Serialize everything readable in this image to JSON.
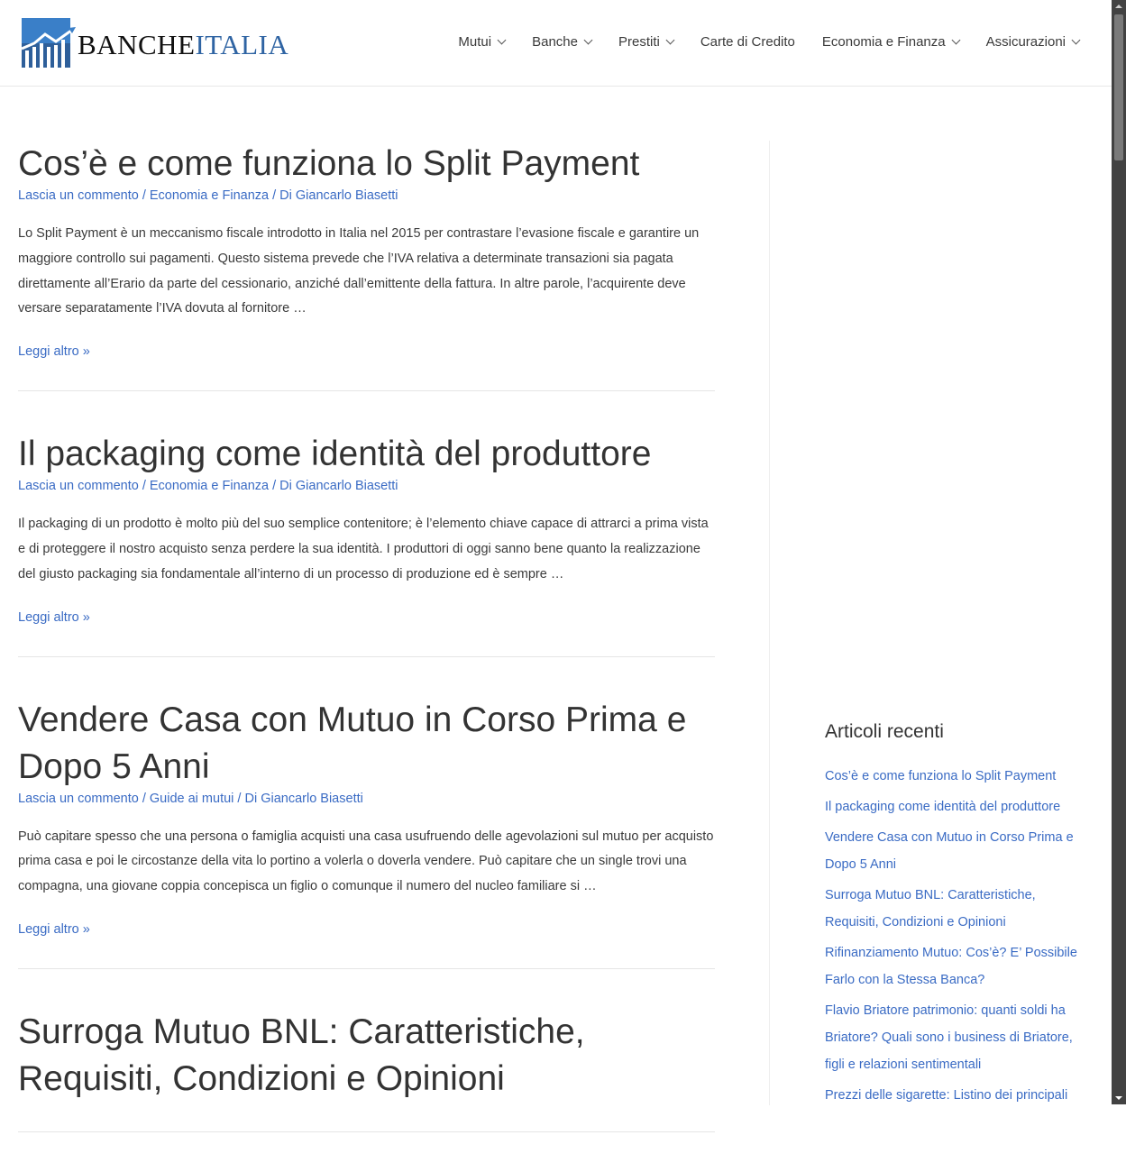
{
  "logo": {
    "part1": "BANCHE",
    "part2": "ITALIA"
  },
  "nav": [
    {
      "label": "Mutui",
      "dropdown": true
    },
    {
      "label": "Banche",
      "dropdown": true
    },
    {
      "label": "Prestiti",
      "dropdown": true
    },
    {
      "label": "Carte di Credito",
      "dropdown": false
    },
    {
      "label": "Economia e Finanza",
      "dropdown": true
    },
    {
      "label": "Assicurazioni",
      "dropdown": true
    }
  ],
  "posts": [
    {
      "title": "Cos’è e come funziona lo Split Payment",
      "comment": "Lascia un commento",
      "category": "Economia e Finanza",
      "author": "Di Giancarlo Biasetti",
      "excerpt": "Lo Split Payment è un meccanismo fiscale introdotto in Italia nel 2015 per contrastare l’evasione fiscale e garantire un maggiore controllo sui pagamenti. Questo sistema prevede che l’IVA relativa a determinate transazioni sia pagata direttamente all’Erario da parte del cessionario, anziché dall’emittente della fattura. In altre parole, l’acquirente deve versare separatamente l’IVA dovuta al fornitore …",
      "more": "Leggi altro »"
    },
    {
      "title": "Il packaging come identità del produttore",
      "comment": "Lascia un commento",
      "category": "Economia e Finanza",
      "author": "Di Giancarlo Biasetti",
      "excerpt": "Il packaging di un prodotto è molto più del suo semplice contenitore; è l’elemento chiave capace di attrarci a prima vista e di proteggere il nostro acquisto senza perdere la sua identità. I produttori di oggi sanno bene quanto la realizzazione del giusto packaging sia fondamentale all’interno di un processo di produzione ed è sempre …",
      "more": "Leggi altro »"
    },
    {
      "title": "Vendere Casa con Mutuo in Corso Prima e Dopo 5 Anni",
      "comment": "Lascia un commento",
      "category": "Guide ai mutui",
      "author": "Di Giancarlo Biasetti",
      "excerpt": "Può capitare spesso che una persona o famiglia acquisti una casa usufruendo delle agevolazioni sul mutuo per acquisto prima casa e poi le circostanze della vita lo portino a volerla o doverla vendere. Può capitare che un single trovi una compagna, una giovane coppia concepisca un figlio o comunque il numero del nucleo familiare si …",
      "more": "Leggi altro »"
    },
    {
      "title": "Surroga Mutuo BNL: Caratteristiche, Requisiti, Condizioni e Opinioni"
    }
  ],
  "sidebar": {
    "title": "Articoli recenti",
    "items": [
      "Cos’è e come funziona lo Split Payment",
      "Il packaging come identità del produttore",
      "Vendere Casa con Mutuo in Corso Prima e Dopo 5 Anni",
      "Surroga Mutuo BNL: Caratteristiche, Requisiti, Condizioni e Opinioni",
      "Rifinanziamento Mutuo: Cos’è? E’ Possibile Farlo con la Stessa Banca?",
      "Flavio Briatore patrimonio: quanti soldi ha Briatore? Quali sono i business di Briatore, figli e relazioni sentimentali",
      "Prezzi delle sigarette: Listino dei principali"
    ]
  }
}
